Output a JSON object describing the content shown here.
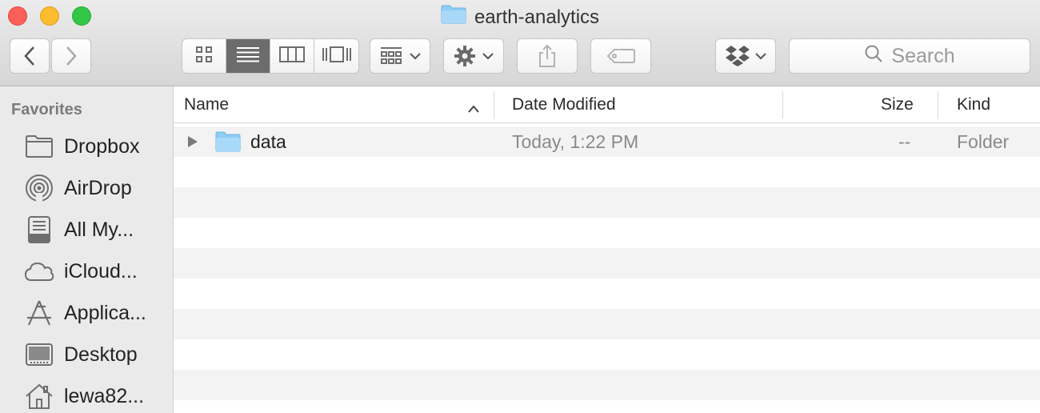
{
  "window": {
    "title": "earth-analytics",
    "title_icon": "folder-icon"
  },
  "toolbar": {
    "back_icon": "chevron-left-icon",
    "forward_icon": "chevron-right-icon",
    "view_modes": [
      {
        "name": "icon-view",
        "icon": "grid-icon",
        "selected": false
      },
      {
        "name": "list-view",
        "icon": "list-icon",
        "selected": true
      },
      {
        "name": "column-view",
        "icon": "columns-icon",
        "selected": false
      },
      {
        "name": "cover-flow-view",
        "icon": "coverflow-icon",
        "selected": false
      }
    ],
    "arrange_icon": "arrange-icon",
    "action_icon": "gear-icon",
    "share_icon": "share-icon",
    "tags_icon": "tag-icon",
    "dropbox_icon": "dropbox-icon",
    "search_placeholder": "Search"
  },
  "sidebar": {
    "heading": "Favorites",
    "items": [
      {
        "label": "Dropbox",
        "icon": "folder-icon"
      },
      {
        "label": "AirDrop",
        "icon": "airdrop-icon"
      },
      {
        "label": "All My...",
        "icon": "all-files-icon"
      },
      {
        "label": "iCloud...",
        "icon": "cloud-icon"
      },
      {
        "label": "Applica...",
        "icon": "applications-icon"
      },
      {
        "label": "Desktop",
        "icon": "desktop-icon"
      },
      {
        "label": "lewa82...",
        "icon": "home-icon"
      }
    ]
  },
  "columns": {
    "name": "Name",
    "date_modified": "Date Modified",
    "size": "Size",
    "kind": "Kind",
    "sort_indicator": "sort-ascending-icon"
  },
  "files": [
    {
      "name": "data",
      "date_modified": "Today, 1:22 PM",
      "size": "--",
      "kind": "Folder",
      "icon": "folder-icon",
      "expandable": true
    }
  ],
  "colors": {
    "folder": "#7cc4f2",
    "selected_view": "#6c6c6c"
  }
}
